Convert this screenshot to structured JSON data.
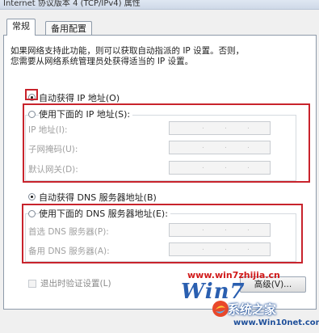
{
  "window": {
    "title": "Internet 协议版本 4 (TCP/IPv4) 属性"
  },
  "tabs": [
    {
      "label": "常规",
      "active": true
    },
    {
      "label": "备用配置",
      "active": false
    }
  ],
  "description": {
    "line1": "如果网络支持此功能，则可以获取自动指派的 IP 设置。否则，",
    "line2": "您需要从网络系统管理员处获得适当的 IP 设置。"
  },
  "ip": {
    "auto_label": "自动获得 IP 地址(O)",
    "auto_selected": true,
    "manual_label": "使用下面的 IP 地址(S):",
    "manual_selected": false,
    "fields": [
      {
        "label": "IP 地址(I):",
        "value": ". . ."
      },
      {
        "label": "子网掩码(U):",
        "value": ". . ."
      },
      {
        "label": "默认网关(D):",
        "value": ". . ."
      }
    ]
  },
  "dns": {
    "auto_label": "自动获得 DNS 服务器地址(B)",
    "auto_selected": true,
    "manual_label": "使用下面的 DNS 服务器地址(E):",
    "manual_selected": false,
    "fields": [
      {
        "label": "首选 DNS 服务器(P):",
        "value": ". . ."
      },
      {
        "label": "备用 DNS 服务器(A):",
        "value": ". . ."
      }
    ]
  },
  "validate_on_exit": {
    "label": "退出时验证设置(L)",
    "checked": false
  },
  "advanced_button": {
    "label": "高级(V)..."
  },
  "watermarks": {
    "url_top": "www.win7zhijia.cn",
    "logo_text": "Win7",
    "brand_name": "系统之家",
    "brand_url": "www.Win10net.com"
  },
  "colors": {
    "highlight_box": "#c8232c",
    "watermark_red": "#d11a1a",
    "brand_blue": "#1e4f9a"
  }
}
